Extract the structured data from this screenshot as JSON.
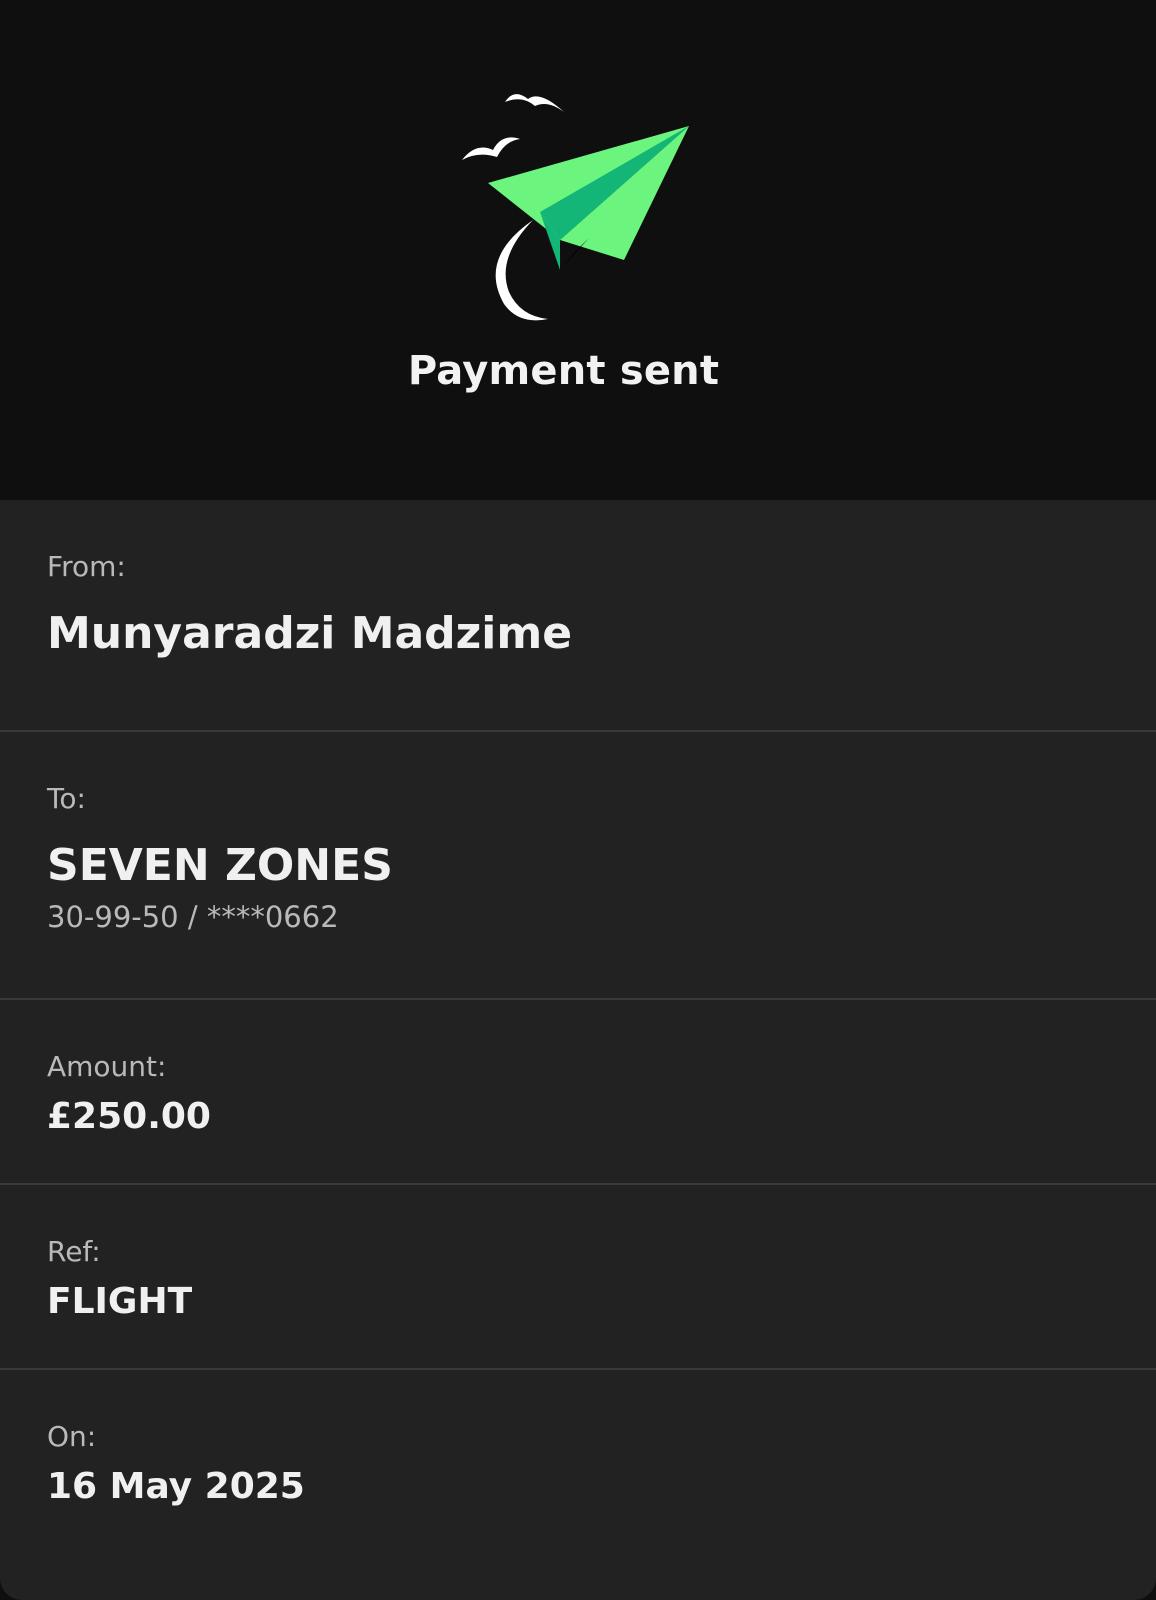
{
  "header": {
    "title": "Payment sent",
    "icon": "paper-plane-icon",
    "accent_color": "#6cf57e",
    "accent_dark": "#13b677"
  },
  "details": {
    "from": {
      "label": "From:",
      "value": "Munyaradzi Madzime"
    },
    "to": {
      "label": "To:",
      "value": "SEVEN ZONES",
      "account": "30-99-50 / ****0662"
    },
    "amount": {
      "label": "Amount:",
      "value": "£250.00"
    },
    "ref": {
      "label": "Ref:",
      "value": "FLIGHT"
    },
    "on": {
      "label": "On:",
      "value": "16 May 2025"
    }
  }
}
